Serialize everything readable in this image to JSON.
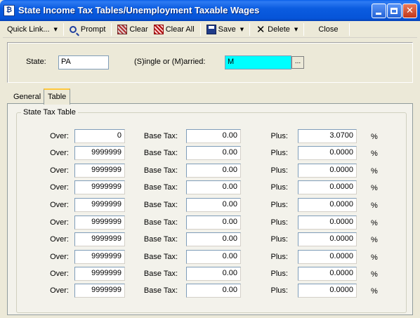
{
  "window": {
    "title": "State Income Tax Tables/Unemployment Taxable Wages",
    "icon": "app-icon"
  },
  "toolbar": {
    "quick_link": "Quick Link...",
    "prompt": "Prompt",
    "clear": "Clear",
    "clear_all": "Clear All",
    "save": "Save",
    "delete": "Delete",
    "close": "Close"
  },
  "header": {
    "state_label": "State:",
    "state_value": "PA",
    "marital_label": "(S)ingle or (M)arried:",
    "marital_value": "M",
    "lookup_label": "..."
  },
  "tabs": [
    "General",
    "Table"
  ],
  "active_tab": "Table",
  "table": {
    "group_title": "State Tax Table",
    "over_label": "Over:",
    "base_tax_label": "Base Tax:",
    "plus_label": "Plus:",
    "pct_label": "%",
    "rows": [
      {
        "over": "0",
        "base_tax": "0.00",
        "plus": "3.0700"
      },
      {
        "over": "9999999",
        "base_tax": "0.00",
        "plus": "0.0000"
      },
      {
        "over": "9999999",
        "base_tax": "0.00",
        "plus": "0.0000"
      },
      {
        "over": "9999999",
        "base_tax": "0.00",
        "plus": "0.0000"
      },
      {
        "over": "9999999",
        "base_tax": "0.00",
        "plus": "0.0000"
      },
      {
        "over": "9999999",
        "base_tax": "0.00",
        "plus": "0.0000"
      },
      {
        "over": "9999999",
        "base_tax": "0.00",
        "plus": "0.0000"
      },
      {
        "over": "9999999",
        "base_tax": "0.00",
        "plus": "0.0000"
      },
      {
        "over": "9999999",
        "base_tax": "0.00",
        "plus": "0.0000"
      },
      {
        "over": "9999999",
        "base_tax": "0.00",
        "plus": "0.0000"
      }
    ]
  },
  "colors": {
    "title_bar": "#0654D8",
    "selected_field": "#00FFFF",
    "active_tab_accent": "#FFC83C"
  }
}
